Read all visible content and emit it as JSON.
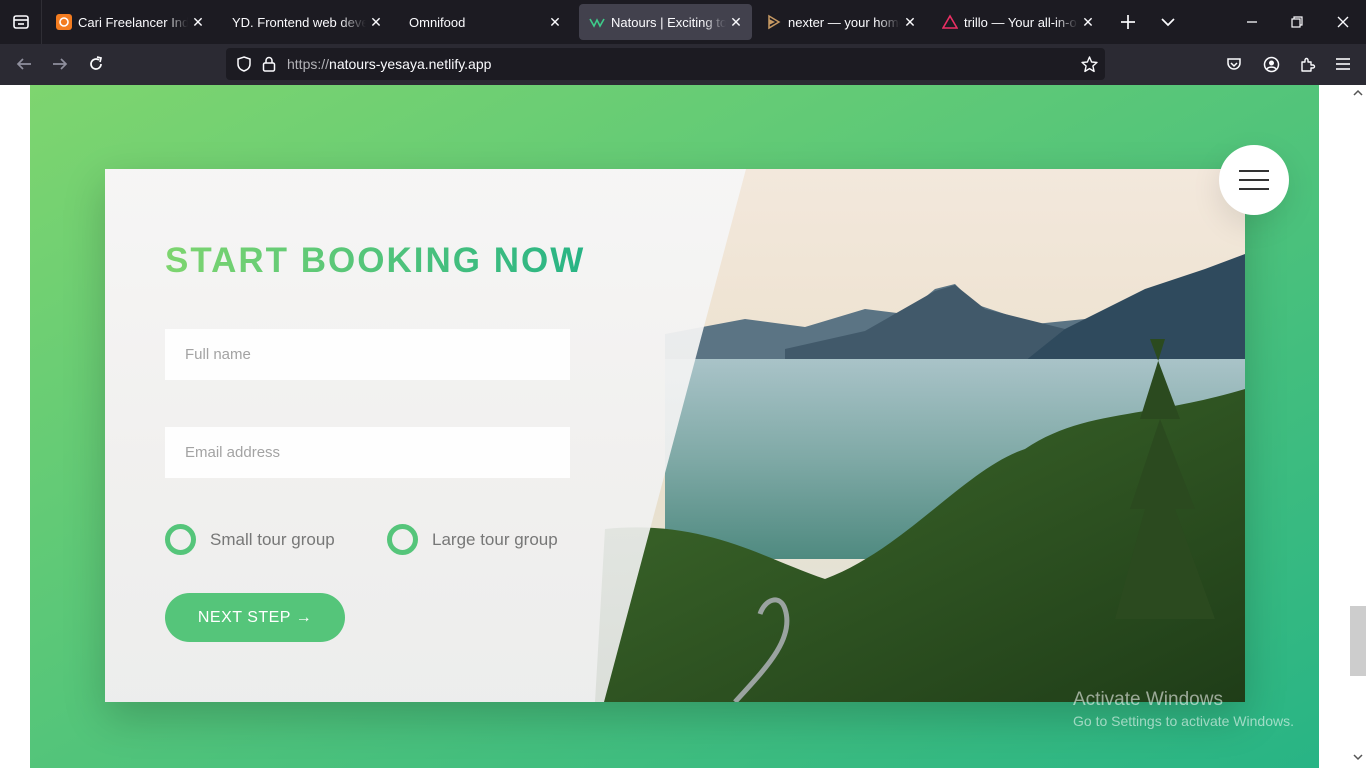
{
  "browser": {
    "tabs": [
      {
        "title": "Cari Freelancer Indonesia",
        "favicon": "projects-orange-icon",
        "active": false
      },
      {
        "title": "YD. Frontend web developer",
        "favicon": "none",
        "active": false
      },
      {
        "title": "Omnifood",
        "favicon": "none",
        "active": false
      },
      {
        "title": "Natours | Exciting tours",
        "favicon": "natours-icon",
        "active": true
      },
      {
        "title": "nexter — your home, your",
        "favicon": "nexter-icon",
        "active": false
      },
      {
        "title": "trillo — Your all-in-one",
        "favicon": "trillo-icon",
        "active": false
      }
    ],
    "url": {
      "scheme": "https://",
      "host": "natours-yesaya.netlify.app"
    }
  },
  "page": {
    "booking": {
      "heading": "START BOOKING NOW",
      "name_placeholder": "Full name",
      "email_placeholder": "Email address",
      "options": [
        "Small tour group",
        "Large tour group"
      ],
      "next_button": "NEXT STEP →"
    }
  },
  "watermark": {
    "title": "Activate Windows",
    "subtitle": "Go to Settings to activate Windows."
  },
  "colors": {
    "accent_light": "#7ed56f",
    "accent_dark": "#28b485",
    "primary": "#55c57a",
    "text_grey": "#777777"
  }
}
